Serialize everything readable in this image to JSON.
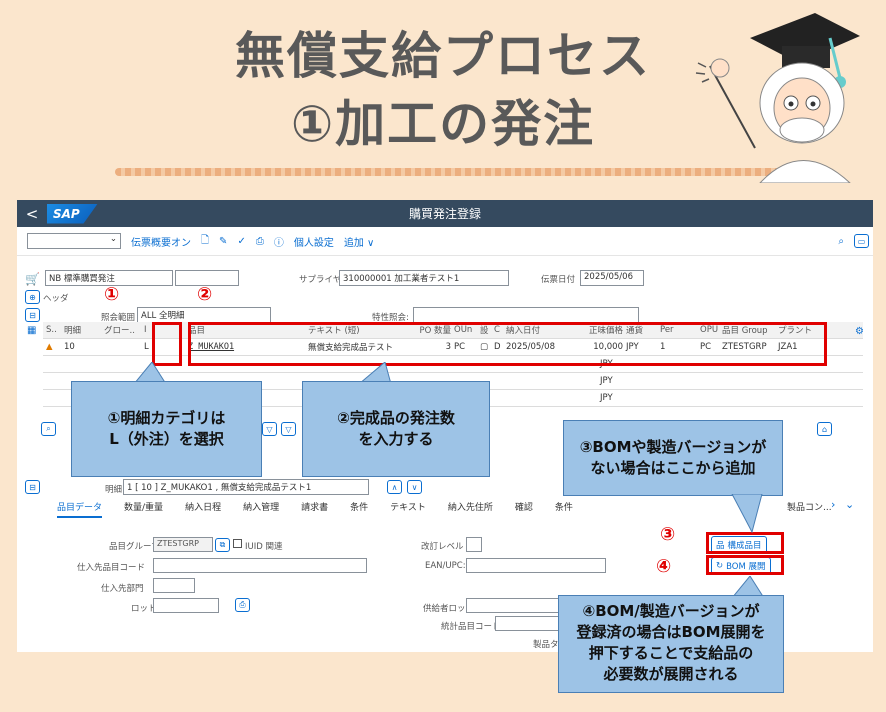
{
  "slide": {
    "title_line1": "無償支給プロセス",
    "title_line2": "①加工の発注"
  },
  "shell": {
    "brand": "SAP",
    "title": "購買発注登録",
    "back_icon": "<"
  },
  "toolbar": {
    "items": [
      "伝票概要オン",
      "個人設定",
      "追加 ∨"
    ]
  },
  "header": {
    "doc_type_value": "NB 標準購買発注",
    "header_label": "ヘッダ",
    "supplier_label": "サプライヤ:",
    "supplier_value": "310000001 加工業者テスト1",
    "doc_date_label": "伝票日付",
    "doc_date_value": "2025/05/06",
    "scope_label": "照会範囲",
    "scope_value": "ALL 全明細",
    "special_label": "特性照会:"
  },
  "grid": {
    "columns": [
      "S..",
      "明細",
      "グロー..",
      "I",
      "品目",
      "テキスト (短)",
      "PO 数量",
      "OUn",
      "設",
      "C",
      "納入日付",
      "正味価格",
      "通貨",
      "Per",
      "OPU",
      "品目 Group",
      "プラント"
    ],
    "row1": [
      "10",
      "L",
      "Z_MUKAKO1",
      "無償支給完成品テスト1",
      "3",
      "PC",
      "D",
      "2025/05/08",
      "10,000",
      "JPY",
      "1",
      "PC",
      "ZTESTGRP",
      "JZA1"
    ],
    "empty_currency": "JPY"
  },
  "item_detail": {
    "label": "明細",
    "value": "1 [ 10 ] Z_MUKAKO1 , 無償支給完成品テスト1",
    "tabs": [
      "品目データ",
      "数量/重量",
      "納入日程",
      "納入管理",
      "請求書",
      "条件",
      "テキスト",
      "納入先住所",
      "確認",
      "条件"
    ],
    "more_tab": "製品コン...",
    "material_group_label": "品目グループ",
    "material_group_value": "ZTESTGRP",
    "iuid_label": "IUID 関連",
    "revision_label": "改訂レベル",
    "vendor_mat_label": "仕入先品目コード",
    "ean_label": "EAN/UPC:",
    "vendor_sub_label": "仕入先部門",
    "batch_label": "ロット:",
    "vendor_batch_label": "供給者ロット",
    "stat_label": "統計品目コード",
    "prod_label": "製品タ...",
    "components_button": "構成品目",
    "bom_button": "BOM 展開"
  },
  "annotations": {
    "n1": "①",
    "n2": "②",
    "n3": "③",
    "n4": "④",
    "callout1_l1": "①明細カテゴリは",
    "callout1_l2": "L（外注）を選択",
    "callout2_l1": "②完成品の発注数",
    "callout2_l2": "を入力する",
    "callout3_l1": "③BOMや製造バージョンが",
    "callout3_l2": "ない場合はここから追加",
    "callout4_l1": "④BOM/製造バージョンが",
    "callout4_l2": "登録済の場合はBOM展開を",
    "callout4_l3": "押下することで支給品の",
    "callout4_l4": "必要数が展開される"
  }
}
